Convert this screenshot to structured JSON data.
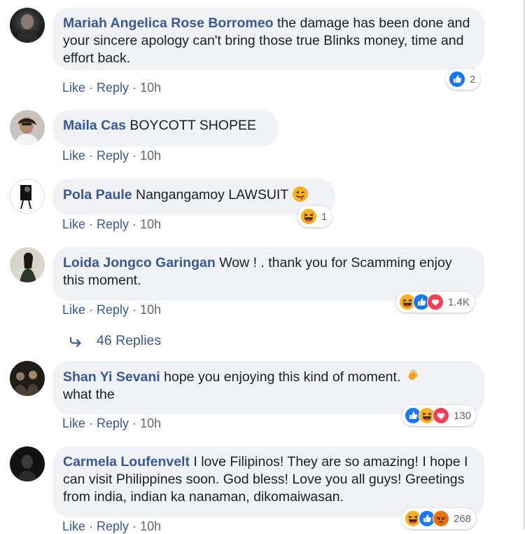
{
  "comments": [
    {
      "author": "Mariah Angelica Rose Borromeo",
      "text": " the damage has been done and your sincere apology can't bring those true Blinks money, time and effort back.",
      "like": "Like",
      "reply": "Reply",
      "time": "10h",
      "reaction_count": "2",
      "reactions": [
        "like-icon"
      ]
    },
    {
      "author": "Maila Cas",
      "text": " BOYCOTT SHOPEE",
      "like": "Like",
      "reply": "Reply",
      "time": "10h"
    },
    {
      "author": "Pola Paule",
      "text": " Nangangamoy LAWSUIT ",
      "like": "Like",
      "reply": "Reply",
      "time": "10h",
      "reaction_count": "1",
      "reactions": [
        "haha-icon"
      ]
    },
    {
      "author": "Loida Jongco Garingan",
      "text": " Wow ! . thank you for Scamming enjoy this moment.",
      "like": "Like",
      "reply": "Reply",
      "time": "10h",
      "reaction_count": "1.4K",
      "reactions": [
        "haha-icon",
        "like-icon",
        "love-icon"
      ]
    },
    {
      "author": "Shan Yi Sevani",
      "text": " hope you enjoying this kind of moment. ",
      "text2": "what the",
      "like": "Like",
      "reply": "Reply",
      "time": "10h",
      "reaction_count": "130",
      "reactions": [
        "like-icon",
        "haha-icon",
        "love-icon"
      ]
    },
    {
      "author": "Carmela Loufenvelt",
      "text": " I love Filipinos! They are so amazing! I hope I can visit Philippines soon. God bless! Love you all guys! Greetings from india, indian ka nanaman, dikomaiwasan.",
      "like": "Like",
      "reply": "Reply",
      "time": "10h",
      "reaction_count": "268",
      "reactions": [
        "haha-icon",
        "like-icon",
        "angry-icon"
      ]
    }
  ],
  "replies_link": "46 Replies",
  "colors": {
    "name": "#385898",
    "bubble": "#f0f2f5",
    "meta": "#606770",
    "like_blue": "#1877f2",
    "love_red": "#f33e58",
    "haha_yellow": "#f7b125",
    "angry_orange": "#e9710f"
  }
}
